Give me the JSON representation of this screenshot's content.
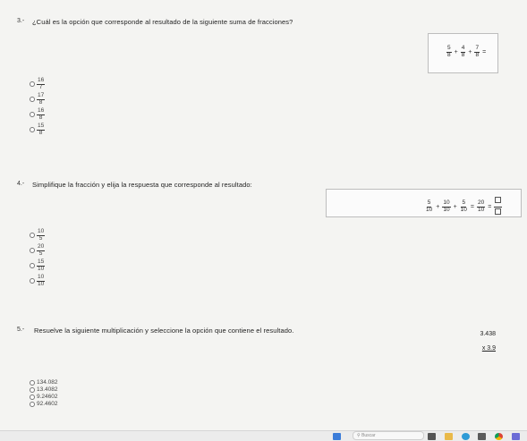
{
  "q3": {
    "number": "3.-",
    "question": "¿Cuál es la opción que corresponde al resultado de la siguiente suma de fracciones?",
    "expr": {
      "terms": [
        {
          "n": "5",
          "d": "8"
        },
        {
          "n": "4",
          "d": "8"
        },
        {
          "n": "7",
          "d": "8"
        }
      ],
      "plus": "+",
      "equals": "="
    },
    "options": [
      {
        "n": "16",
        "d": "7"
      },
      {
        "n": "17",
        "d": "8"
      },
      {
        "n": "16",
        "d": "8"
      },
      {
        "n": "15",
        "d": "8"
      }
    ]
  },
  "q4": {
    "number": "4.-",
    "question": "Simplifique la fracción y elija la respuesta que corresponde al resultado:",
    "expr": {
      "terms": [
        {
          "n": "5",
          "d": "10"
        },
        {
          "n": "10",
          "d": "10"
        },
        {
          "n": "5",
          "d": "10"
        }
      ],
      "sum": {
        "n": "20",
        "d": "10"
      },
      "plus": "+",
      "equals": "="
    },
    "options": [
      {
        "n": "10",
        "d": "5"
      },
      {
        "n": "20",
        "d": "5"
      },
      {
        "n": "15",
        "d": "10"
      },
      {
        "n": "10",
        "d": "10"
      }
    ]
  },
  "q5": {
    "number": "5.-",
    "question": "Resuelve la siguiente multiplicación y seleccione la opción que contiene el resultado.",
    "multiplicand": "3.438",
    "multiplier": "x 3.9",
    "options": [
      "134.082",
      "13.4082",
      "9.24602",
      "92.4602"
    ]
  },
  "taskbar": {
    "search_label": "Buscar"
  }
}
